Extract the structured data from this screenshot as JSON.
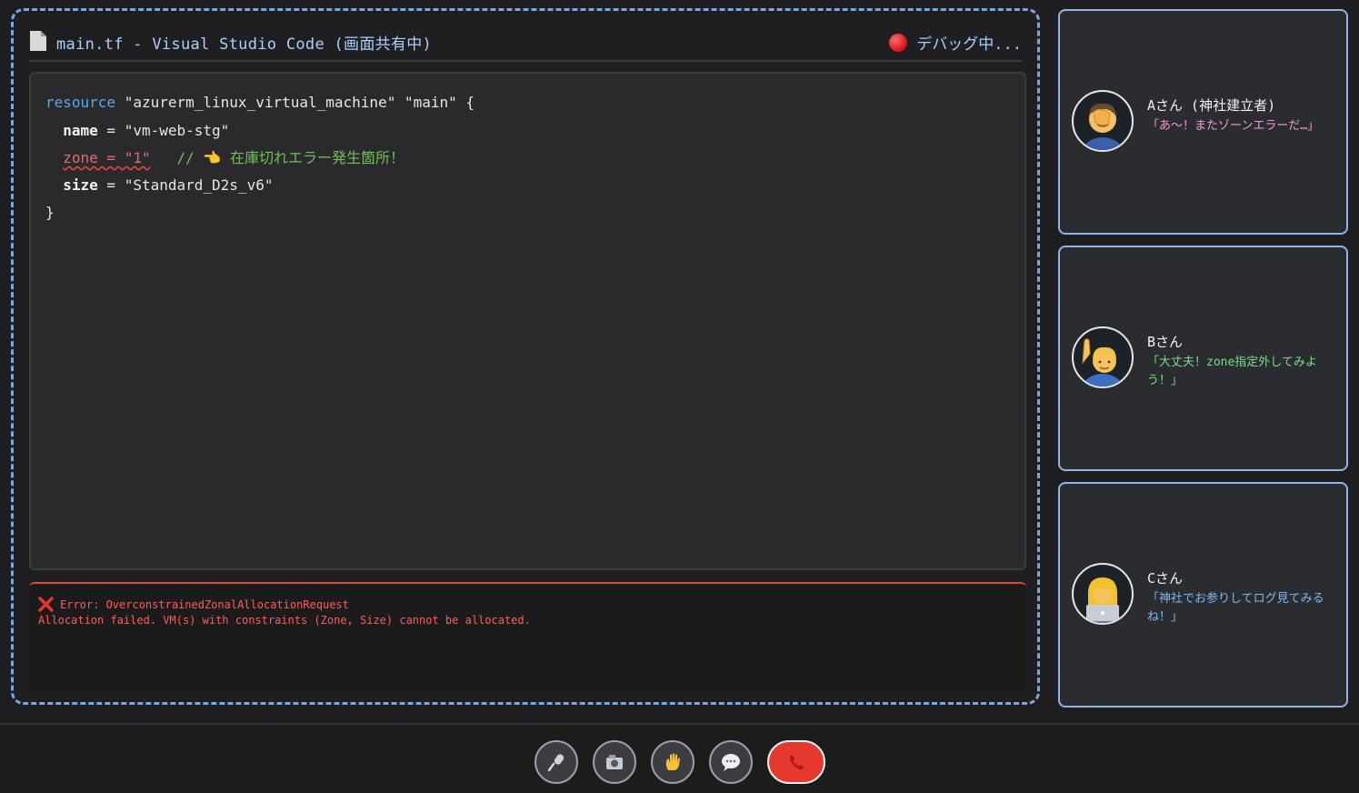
{
  "window": {
    "title": "main.tf - Visual Studio Code (画面共有中)",
    "status": "デバッグ中..."
  },
  "editor": {
    "line1": {
      "keyword": "resource",
      "type": "\"azurerm_linux_virtual_machine\"",
      "name": "\"main\"",
      "brace": "{"
    },
    "line2": {
      "prop": "name",
      "eq": " = ",
      "value": "\"vm-web-stg\""
    },
    "line3": {
      "code": "zone = \"1\"",
      "comment": "// 👈 在庫切れエラー発生箇所！"
    },
    "line4": {
      "prop": "size",
      "eq": " = ",
      "value": "\"Standard_D2s_v6\""
    },
    "line5": "}"
  },
  "console": {
    "error_title": "Error: OverconstrainedZonalAllocationRequest",
    "error_detail": "Allocation failed. VM(s) with constraints (Zone, Size) cannot be allocated."
  },
  "participants": [
    {
      "name": "Aさん (神社建立者)",
      "quote": "「あ～！またゾーンエラーだ…」",
      "quote_color": "#f29bd6",
      "avatar": "facepalm-person-icon"
    },
    {
      "name": "Bさん",
      "quote": "「大丈夫！zone指定外してみよう！」",
      "quote_color": "#7fdc8c",
      "avatar": "raising-hand-person-icon"
    },
    {
      "name": "Cさん",
      "quote": "「神社でお参りしてログ見てみるね！」",
      "quote_color": "#7fb8f2",
      "avatar": "person-with-laptop-icon"
    }
  ],
  "controls": [
    "mic-icon",
    "camera-icon",
    "raise-hand-icon",
    "chat-icon",
    "end-call-icon"
  ],
  "colors": {
    "accent": "#7aa7e0",
    "error": "#ff5c5c",
    "end_call": "#e5382e"
  }
}
